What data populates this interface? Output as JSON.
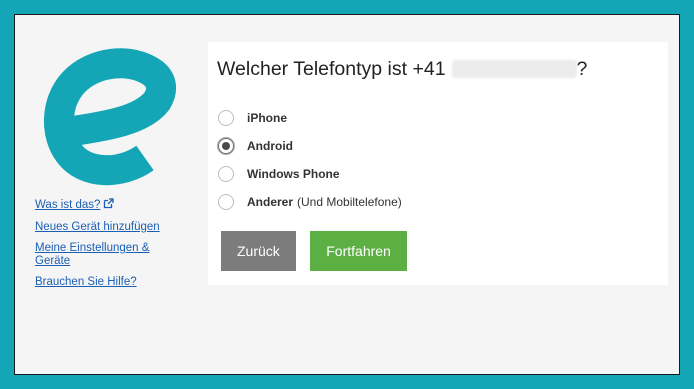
{
  "sidebar": {
    "logo_color": "#14a6b7",
    "links": [
      {
        "label": "Was ist das?",
        "icon": "external-link-icon"
      },
      {
        "label": "Neues Gerät hinzufügen"
      },
      {
        "label": "Meine Einstellungen & Geräte"
      },
      {
        "label": "Brauchen Sie Hilfe?"
      }
    ]
  },
  "main": {
    "title_prefix": "Welcher Telefontyp ist +41",
    "title_suffix": "?",
    "options": [
      {
        "label": "iPhone",
        "sublabel": "",
        "checked": false
      },
      {
        "label": "Android",
        "sublabel": "",
        "checked": true
      },
      {
        "label": "Windows Phone",
        "sublabel": "",
        "checked": false
      },
      {
        "label": "Anderer",
        "sublabel": "(Und Mobiltelefone)",
        "checked": false
      }
    ],
    "buttons": {
      "back_label": "Zurück",
      "continue_label": "Fortfahren"
    }
  },
  "colors": {
    "background": "#14a6b7",
    "link": "#1b5fb5",
    "back_button": "#7c7c7c",
    "continue_button": "#5cb043"
  }
}
